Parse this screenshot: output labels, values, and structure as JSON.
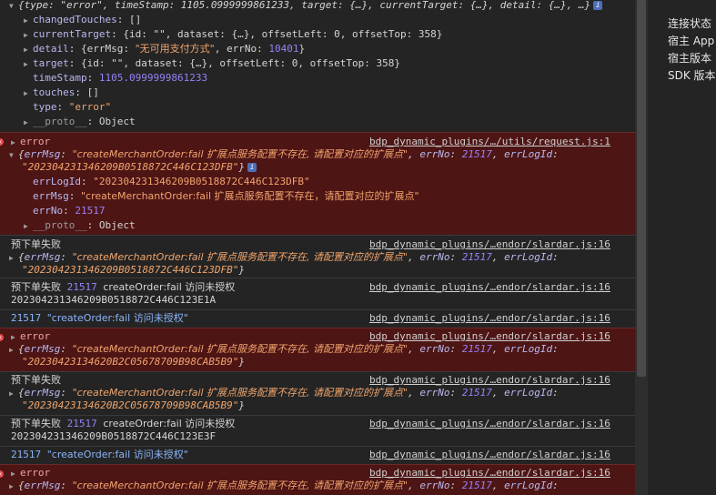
{
  "top_object": {
    "summary": "{type: \"error\", timeStamp: 1105.0999999861233, target: {…}, currentTarget: {…}, detail: {…}, …}",
    "info_badge": "i",
    "props": {
      "changedTouches_k": "changedTouches",
      "changedTouches_v": "[]",
      "currentTarget_k": "currentTarget",
      "currentTarget_v": "{id: \"\", dataset: {…}, offsetLeft: 0, offsetTop: 358}",
      "detail_k": "detail",
      "detail_v1": "{errMsg: ",
      "detail_s": "\"无可用支付方式\"",
      "detail_v2": ", errNo: ",
      "detail_n": "10401",
      "detail_v3": "}",
      "target_k": "target",
      "target_v": "{id: \"\", dataset: {…}, offsetLeft: 0, offsetTop: 358}",
      "timeStamp_k": "timeStamp",
      "timeStamp_v": "1105.0999999861233",
      "touches_k": "touches",
      "touches_v": "[]",
      "type_k": "type",
      "type_v": "\"error\"",
      "proto_k": "__proto__",
      "proto_v": "Object"
    }
  },
  "sources": {
    "request": "bdp_dynamic_plugins/…/utils/request.js:1",
    "slardar": "bdp_dynamic_plugins/…endor/slardar.js:16"
  },
  "error_label": "error",
  "msg": {
    "errMsg_k": "errMsg",
    "errMsg_v": "\"createMerchantOrder:fail 扩展点服务配置不存在, 请配置对应的扩展点\"",
    "errMsg_v_plain": "\"createMerchantOrder:fail 扩展点服务配置不存在，请配置对应的扩展点\"",
    "errNo_k": "errNo",
    "errNo_v": "21517",
    "errLogId_k": "errLogId",
    "logid1": "\"20230423134620 9B0518872C446C123DFB\"",
    "logid1_short": "\"202304231346209B0518872C446C123DFB\"",
    "logid2": "\"20230423134620B2C05678709B98CAB5B9\"",
    "proto_k": "__proto__",
    "proto_v": "Object"
  },
  "log": {
    "prepay_fail": "预下单失败",
    "code": "21517",
    "create_fail": "createOrder:fail 访问未授权",
    "create_fail_q": "\"createOrder:fail 访问未授权\"",
    "id1": "202304231346209B0518872C446C123E1A",
    "id2": "202304231346209B0518872C446C123E3F"
  },
  "side": {
    "item1": "连接状态",
    "item2": "宿主 App",
    "item3": "宿主版本",
    "item4": "SDK 版本"
  }
}
